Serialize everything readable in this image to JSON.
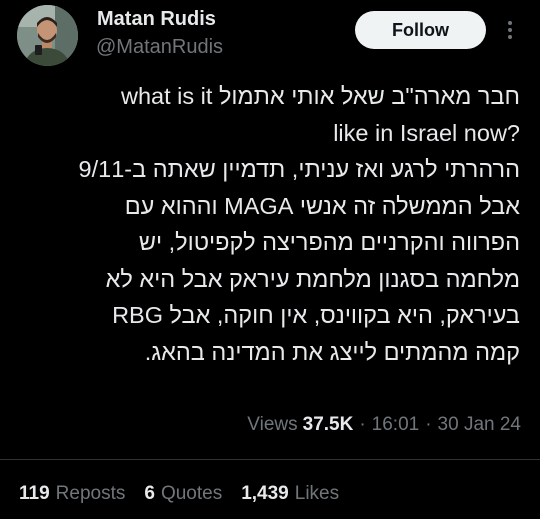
{
  "author": {
    "name": "Matan Rudis",
    "handle": "@MatanRudis"
  },
  "follow_label": "Follow",
  "more_icon": "more-vertical-icon",
  "tweet_lines": [
    "חבר מארה\"ב שאל אותי אתמול what is it",
    "like in Israel now?",
    "הרהרתי לרגע ואז עניתי, תדמיין שאתה ב-9/11",
    "אבל הממשלה זה אנשי MAGA וההוא עם",
    "הפרווה והקרניים מהפריצה לקפיטול, יש",
    "מלחמה בסגנון מלחמת עיראק אבל היא לא",
    "בעיראק, היא בקווינס, אין חוקה, אבל RBG",
    "קמה מהמתים לייצג את המדינה בהאג."
  ],
  "meta": {
    "views_label": "Views",
    "views_count": "37.5K",
    "separator": "·",
    "time": "16:01",
    "date": "30 Jan 24"
  },
  "stats": {
    "reposts_count": "119",
    "reposts_label": "Reposts",
    "quotes_count": "6",
    "quotes_label": "Quotes",
    "likes_count": "1,439",
    "likes_label": "Likes"
  },
  "colors": {
    "background": "#000000",
    "text_primary": "#e7e9ea",
    "text_secondary": "#71767b",
    "follow_button_bg": "#eff3f4",
    "divider": "#2f3336"
  }
}
